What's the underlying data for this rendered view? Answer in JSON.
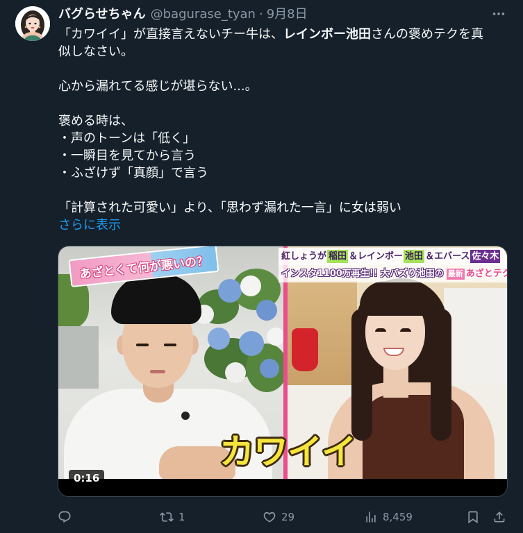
{
  "tweet": {
    "author": {
      "avatar_icon": "avatar-illustration-icon",
      "display_name": "バグらせちゃん",
      "handle": "@bagurase_tyan",
      "separator": "·",
      "date": "9月8日"
    },
    "more_icon": "more-horizontal-icon",
    "body": {
      "line1": {
        "pre": "「カワイイ」が直接言えないチー牛は、",
        "bold": "レインボー池田",
        "post": "さんの褒めテクを真"
      },
      "line2": "似しなさい。",
      "line3": "心から漏れてる感じが堪らない...。",
      "line4": "褒める時は、",
      "line5": "・声のトーンは「低く」",
      "line6": "・一瞬目を見てから言う",
      "line7": "・ふざけず「真顔」で言う",
      "line8": "「計算された可愛い」より、「思わず漏れた一言」に女は弱い",
      "show_more": "さらに表示"
    },
    "media": {
      "duration": "0:16",
      "frame": {
        "show_logo": "あざとくて何が悪いの？",
        "caption_line1": [
          "紅しょうが",
          "稲田",
          "＆レインボー",
          "池田",
          "＆エバース",
          "佐々木"
        ],
        "caption_line2": [
          "インスタ1100万再生!!",
          "大バズり池田の",
          "最新",
          "あざとテク"
        ],
        "subtitle": "カワイイ"
      }
    },
    "actions": {
      "reply": {
        "icon": "reply-icon"
      },
      "retweet": {
        "icon": "retweet-icon",
        "count": "1"
      },
      "like": {
        "icon": "heart-icon",
        "count": "29"
      },
      "views": {
        "icon": "views-icon",
        "count": "8,459"
      },
      "bookmark": {
        "icon": "bookmark-icon"
      },
      "share": {
        "icon": "share-icon"
      }
    }
  },
  "theme": {
    "background": "#15202b",
    "text": "#f7f9f9",
    "secondary_text": "#8b98a5",
    "link": "#1d9bf0",
    "subtitle_yellow": "#f6e53b",
    "divider_pink": "#ea4d8c"
  }
}
